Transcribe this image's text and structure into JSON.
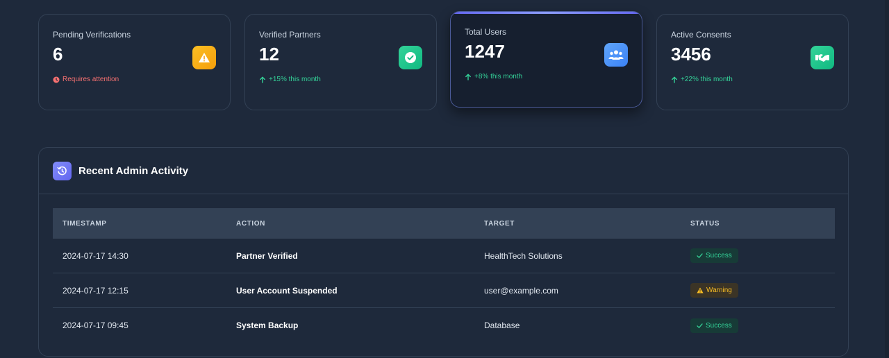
{
  "stats": [
    {
      "label": "Pending Verifications",
      "value": "6",
      "note": "Requires attention",
      "note_type": "danger",
      "icon": "warning-icon"
    },
    {
      "label": "Verified Partners",
      "value": "12",
      "note": "+15% this month",
      "note_type": "success",
      "icon": "check-circle-icon"
    },
    {
      "label": "Total Users",
      "value": "1247",
      "note": "+8% this month",
      "note_type": "success",
      "icon": "users-icon"
    },
    {
      "label": "Active Consents",
      "value": "3456",
      "note": "+22% this month",
      "note_type": "success",
      "icon": "handshake-icon"
    }
  ],
  "activity": {
    "title": "Recent Admin Activity",
    "columns": [
      "TIMESTAMP",
      "ACTION",
      "TARGET",
      "STATUS"
    ],
    "rows": [
      {
        "timestamp": "2024-07-17 14:30",
        "action": "Partner Verified",
        "target": "HealthTech Solutions",
        "status": "Success"
      },
      {
        "timestamp": "2024-07-17 12:15",
        "action": "User Account Suspended",
        "target": "user@example.com",
        "status": "Warning"
      },
      {
        "timestamp": "2024-07-17 09:45",
        "action": "System Backup",
        "target": "Database",
        "status": "Success"
      }
    ]
  },
  "colors": {
    "background": "#1e293b",
    "accent": "#6366f1",
    "success": "#34d399",
    "warning": "#fbbf24",
    "danger": "#f87171"
  }
}
